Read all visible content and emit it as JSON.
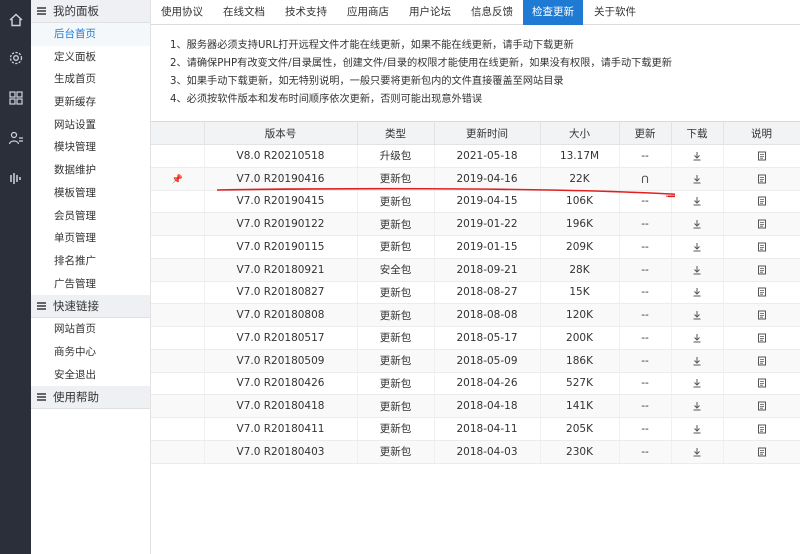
{
  "sidebar": {
    "groups": [
      {
        "title": "我的面板",
        "items": [
          "后台首页",
          "定义面板",
          "生成首页",
          "更新缓存",
          "网站设置",
          "模块管理",
          "数据维护",
          "模板管理",
          "会员管理",
          "单页管理",
          "排名推广",
          "广告管理"
        ]
      },
      {
        "title": "快速链接",
        "items": [
          "网站首页",
          "商务中心",
          "安全退出"
        ]
      },
      {
        "title": "使用帮助",
        "items": []
      }
    ],
    "active_item": "后台首页"
  },
  "tabs": [
    "使用协议",
    "在线文档",
    "技术支持",
    "应用商店",
    "用户论坛",
    "信息反馈",
    "检查更新",
    "关于软件"
  ],
  "active_tab": "检查更新",
  "notes": [
    "1、服务器必须支持URL打开远程文件才能在线更新，如果不能在线更新，请手动下载更新",
    "2、请确保PHP有改变文件/目录属性，创建文件/目录的权限才能使用在线更新，如果没有权限，请手动下载更新",
    "3、如果手动下载更新，如无特别说明，一般只要将更新包内的文件直接覆盖至网站目录",
    "4、必须按软件版本和发布时间顺序依次更新，否则可能出现意外错误"
  ],
  "table": {
    "headers": [
      "版本号",
      "类型",
      "更新时间",
      "大小",
      "更新",
      "下载",
      "说明"
    ],
    "rows": [
      {
        "version": "V8.0 R20210518",
        "type": "升级包",
        "kind": "upgrade",
        "date": "2021-05-18",
        "size": "13.17M",
        "update": "--",
        "pinned": false
      },
      {
        "version": "V7.0 R20190416",
        "type": "更新包",
        "kind": "update",
        "date": "2019-04-16",
        "size": "22K",
        "update": "icon",
        "pinned": true
      },
      {
        "version": "V7.0 R20190415",
        "type": "更新包",
        "kind": "update",
        "date": "2019-04-15",
        "size": "106K",
        "update": "--",
        "pinned": false
      },
      {
        "version": "V7.0 R20190122",
        "type": "更新包",
        "kind": "update",
        "date": "2019-01-22",
        "size": "196K",
        "update": "--",
        "pinned": false
      },
      {
        "version": "V7.0 R20190115",
        "type": "更新包",
        "kind": "update",
        "date": "2019-01-15",
        "size": "209K",
        "update": "--",
        "pinned": false
      },
      {
        "version": "V7.0 R20180921",
        "type": "安全包",
        "kind": "security",
        "date": "2018-09-21",
        "size": "28K",
        "update": "--",
        "pinned": false
      },
      {
        "version": "V7.0 R20180827",
        "type": "更新包",
        "kind": "update",
        "date": "2018-08-27",
        "size": "15K",
        "update": "--",
        "pinned": false
      },
      {
        "version": "V7.0 R20180808",
        "type": "更新包",
        "kind": "update",
        "date": "2018-08-08",
        "size": "120K",
        "update": "--",
        "pinned": false
      },
      {
        "version": "V7.0 R20180517",
        "type": "更新包",
        "kind": "update",
        "date": "2018-05-17",
        "size": "200K",
        "update": "--",
        "pinned": false
      },
      {
        "version": "V7.0 R20180509",
        "type": "更新包",
        "kind": "update",
        "date": "2018-05-09",
        "size": "186K",
        "update": "--",
        "pinned": false
      },
      {
        "version": "V7.0 R20180426",
        "type": "更新包",
        "kind": "update",
        "date": "2018-04-26",
        "size": "527K",
        "update": "--",
        "pinned": false
      },
      {
        "version": "V7.0 R20180418",
        "type": "更新包",
        "kind": "update",
        "date": "2018-04-18",
        "size": "141K",
        "update": "--",
        "pinned": false
      },
      {
        "version": "V7.0 R20180411",
        "type": "更新包",
        "kind": "update",
        "date": "2018-04-11",
        "size": "205K",
        "update": "--",
        "pinned": false
      },
      {
        "version": "V7.0 R20180403",
        "type": "更新包",
        "kind": "update",
        "date": "2018-04-03",
        "size": "230K",
        "update": "--",
        "pinned": false
      }
    ]
  },
  "icons": {
    "rail": [
      "home-icon",
      "gear-icon",
      "grid-icon",
      "user-list-icon",
      "equalizer-icon"
    ],
    "download": "download-arrow-icon",
    "doc": "document-icon",
    "update": "update-link-icon",
    "pin": "pin-icon"
  },
  "colors": {
    "accent": "#1e7ad3",
    "rail": "#2b2f3a",
    "upgrade": "#1e3fb8",
    "update": "#2a9a2a",
    "security": "#e07a1a",
    "annotation": "#e02020"
  }
}
